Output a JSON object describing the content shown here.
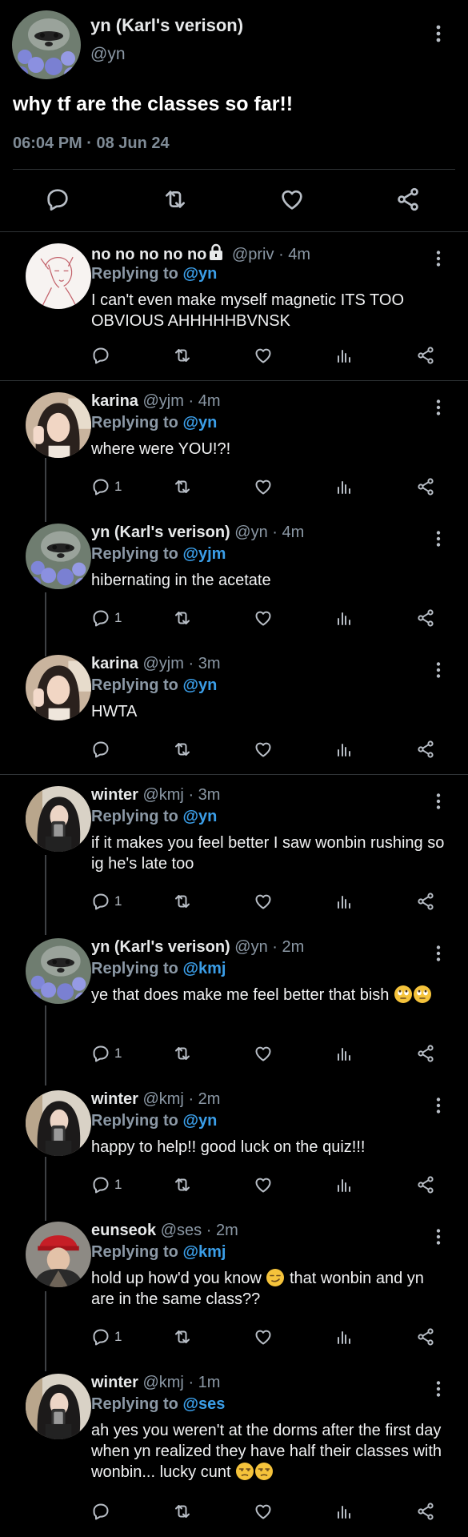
{
  "main_tweet": {
    "name": "yn (Karl's verison)",
    "handle": "@yn",
    "text": "why tf are the classes so far!!",
    "meta": "06:04 PM · 08 Jun 24"
  },
  "replies": [
    {
      "name": "no no no no no",
      "locked": true,
      "handle": "@priv",
      "time": "4m",
      "replying_prefix": "Replying to",
      "replying_to": "@yn",
      "text": "I can't even make myself magnetic ITS TOO OBVIOUS AHHHHHBVNSK",
      "reply_count": "",
      "avatar": "sketch"
    },
    {
      "name": "karina",
      "handle": "@yjm",
      "time": "4m",
      "replying_prefix": "Replying to",
      "replying_to": "@yn",
      "text": "where were YOU!?!",
      "reply_count": "1",
      "avatar": "karina"
    },
    {
      "name": "yn (Karl's verison)",
      "handle": "@yn",
      "time": "4m",
      "replying_prefix": "Replying to",
      "replying_to": "@yjm",
      "text": "hibernating in the acetate",
      "reply_count": "1",
      "avatar": "raccoon"
    },
    {
      "name": "karina",
      "handle": "@yjm",
      "time": "3m",
      "replying_prefix": "Replying to",
      "replying_to": "@yn",
      "text": "HWTA",
      "reply_count": "",
      "avatar": "karina"
    },
    {
      "name": "winter",
      "handle": "@kmj",
      "time": "3m",
      "replying_prefix": "Replying to",
      "replying_to": "@yn",
      "text": "if it makes you feel better I saw wonbin rushing so ig he's late too",
      "reply_count": "1",
      "avatar": "winter"
    },
    {
      "name": "yn (Karl's verison)",
      "handle": "@yn",
      "time": "2m",
      "replying_prefix": "Replying to",
      "replying_to": "@kmj",
      "text": "ye that does make me feel better that bish",
      "reply_count": "1",
      "avatar": "raccoon"
    },
    {
      "name": "winter",
      "handle": "@kmj",
      "time": "2m",
      "replying_prefix": "Replying to",
      "replying_to": "@yn",
      "text": "happy to help!! good luck on the quiz!!!",
      "reply_count": "1",
      "avatar": "winter"
    },
    {
      "name": "eunseok",
      "handle": "@ses",
      "time": "2m",
      "replying_prefix": "Replying to",
      "replying_to": "@kmj",
      "text": "hold up how'd you know",
      "text2": "that wonbin and yn are in the same class??",
      "reply_count": "1",
      "avatar": "eunseok"
    },
    {
      "name": "winter",
      "handle": "@kmj",
      "time": "1m",
      "replying_prefix": "Replying to",
      "replying_to": "@ses",
      "text": "ah yes you weren't at the dorms after the first day when yn realized they have half their classes with wonbin... lucky cunt",
      "reply_count": "",
      "avatar": "winter"
    }
  ],
  "icons": {
    "reply": "reply-icon",
    "retweet": "retweet-icon",
    "like": "heart-icon",
    "views": "views-icon",
    "share": "share-icon",
    "more": "more-vertical-icon",
    "lock": "lock-icon"
  },
  "colors": {
    "background": "#000000",
    "link": "#3b9ee8",
    "muted": "#8b98a5",
    "separator": "#2f3336"
  }
}
